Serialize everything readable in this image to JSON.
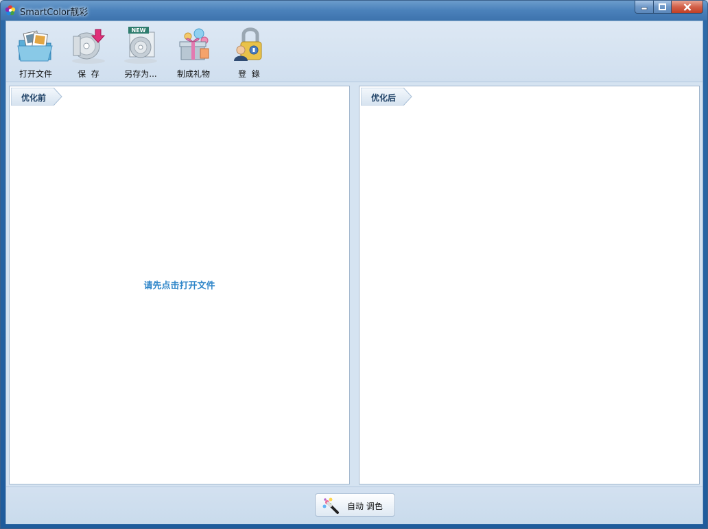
{
  "window": {
    "title": "SmartColor靓彩",
    "controls": [
      "minimize",
      "maximize",
      "close"
    ]
  },
  "toolbar": {
    "items": [
      {
        "label": "打开文件",
        "icon": "open-folder-icon"
      },
      {
        "label": "保  存",
        "icon": "save-disc-icon"
      },
      {
        "label": "另存为...",
        "icon": "save-as-new-icon"
      },
      {
        "label": "制成礼物",
        "icon": "gift-icon"
      },
      {
        "label": "登  錄",
        "icon": "login-lock-icon"
      }
    ],
    "new_badge": "NEW"
  },
  "panels": {
    "before": {
      "tab_label": "优化前",
      "placeholder": "请先点击打开文件"
    },
    "after": {
      "tab_label": "优化后"
    }
  },
  "bottom": {
    "auto_adjust_label": "自动 调色",
    "icon": "magic-wand-icon"
  },
  "colors": {
    "titlebar": "#4b82bb",
    "client_bg": "#d5e3f1",
    "placeholder_text": "#2f86c9",
    "tab_text": "#1b3e63"
  }
}
